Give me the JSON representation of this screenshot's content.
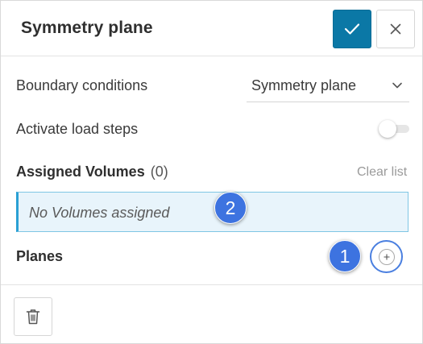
{
  "header": {
    "title": "Symmetry plane",
    "confirm_icon": "check-icon",
    "close_icon": "close-icon",
    "accent_color": "#0b78a6"
  },
  "boundary_conditions": {
    "label": "Boundary conditions",
    "selected": "Symmetry plane"
  },
  "load_steps": {
    "label": "Activate load steps",
    "enabled": false
  },
  "assigned_volumes": {
    "title": "Assigned Volumes",
    "count": "(0)",
    "clear_label": "Clear list",
    "empty_text": "No Volumes assigned"
  },
  "planes": {
    "title": "Planes",
    "add_icon": "plus-icon"
  },
  "annotations": {
    "badge_1": "1",
    "badge_2": "2",
    "badge_color": "#3d73e0"
  },
  "footer": {
    "delete_icon": "trash-icon"
  }
}
